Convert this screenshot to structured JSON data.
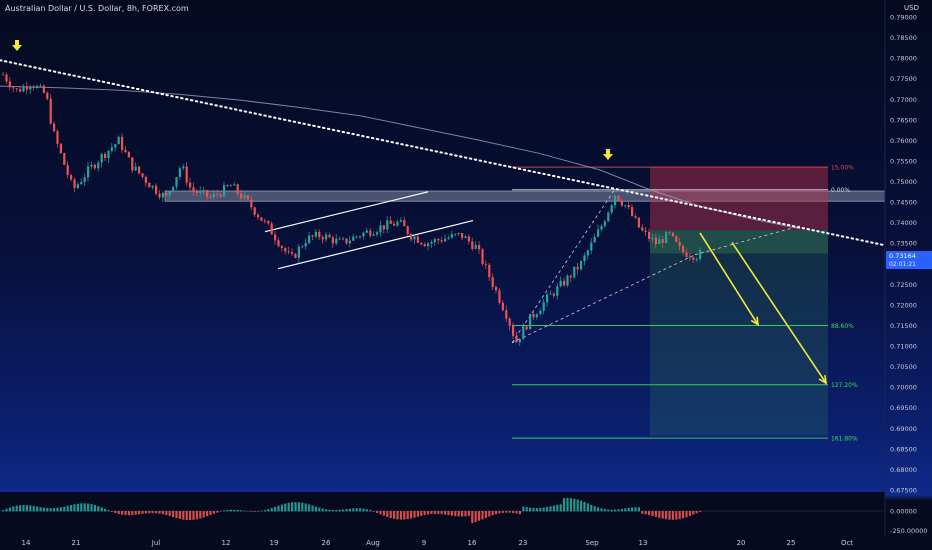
{
  "chart_data": {
    "type": "candlestick",
    "title": "Australian Dollar / U.S. Dollar, 8h, FOREX.com",
    "currency": "USD",
    "ylim": [
      0.675,
      0.79
    ],
    "y_ticks": [
      "0.79000",
      "0.78500",
      "0.78000",
      "0.77500",
      "0.77000",
      "0.76500",
      "0.76000",
      "0.75500",
      "0.75000",
      "0.74500",
      "0.74000",
      "0.73500",
      "0.73000",
      "0.72500",
      "0.72000",
      "0.71500",
      "0.71000",
      "0.70500",
      "0.70000",
      "0.69500",
      "0.69000",
      "0.68500",
      "0.68000",
      "0.67500"
    ],
    "x_ticks": [
      "14",
      "21",
      "Jul",
      "12",
      "19",
      "26",
      "Aug",
      "9",
      "16",
      "23",
      "Sep",
      "13",
      "20",
      "25",
      "Oct"
    ],
    "price_label": "0.73164",
    "countdown_label": "02:01:21",
    "fib_levels": [
      {
        "label": "15.00%",
        "price": 0.7535,
        "color": "#e0484f"
      },
      {
        "label": "0.00%",
        "price": 0.748,
        "color": "#cfd6e6"
      },
      {
        "label": "88.60%",
        "price": 0.715,
        "color": "#3ddc5a"
      },
      {
        "label": "127.20%",
        "price": 0.7006,
        "color": "#3ddc5a"
      },
      {
        "label": "161.80%",
        "price": 0.6876,
        "color": "#3ddc5a"
      }
    ],
    "oscillator_ticks": [
      "0.00000",
      "-250.00000"
    ],
    "colors": {
      "up": "#26a69a",
      "down": "#ef5350",
      "arrow": "#f5e63a",
      "trend": "#ffffff",
      "ma": "#9aa0b8"
    }
  }
}
